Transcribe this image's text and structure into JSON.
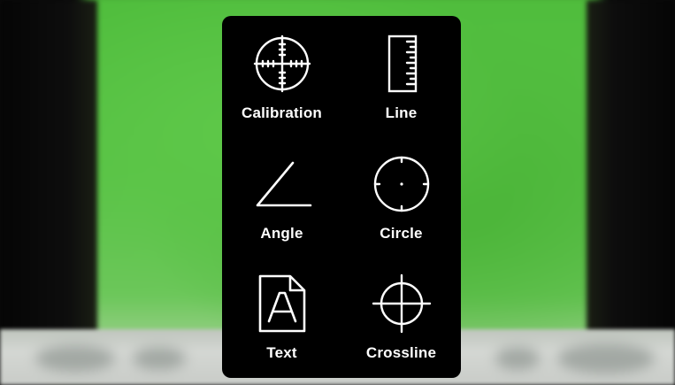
{
  "menu": {
    "items": [
      {
        "id": "calibration",
        "label": "Calibration",
        "icon": "calibration-crosshair-icon"
      },
      {
        "id": "line",
        "label": "Line",
        "icon": "ruler-icon"
      },
      {
        "id": "angle",
        "label": "Angle",
        "icon": "angle-icon"
      },
      {
        "id": "circle",
        "label": "Circle",
        "icon": "circle-icon"
      },
      {
        "id": "text",
        "label": "Text",
        "icon": "text-document-icon"
      },
      {
        "id": "crossline",
        "label": "Crossline",
        "icon": "crosshair-icon"
      }
    ]
  },
  "colors": {
    "panel_background": "#000000",
    "icon_stroke": "#ffffff",
    "label_text": "#ffffff",
    "background_green": "#55bf42"
  }
}
